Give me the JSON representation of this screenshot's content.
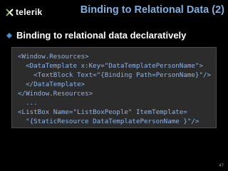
{
  "logo": {
    "text": "telerik"
  },
  "slide": {
    "title": "Binding to Relational Data (2)",
    "bullet": "Binding to relational data declaratively",
    "code_lines": [
      "<Window.Resources>",
      "  <DataTemplate x:Key=\"DataTemplatePersonName\">",
      "    <TextBlock Text=\"{Binding Path=PersonName}\"/>",
      "  </DataTemplate>",
      "</Window.Resources>",
      "  ...",
      "<ListBox Name=\"ListBoxPeople\" ItemTemplate=",
      "  \"{StaticResource DataTemplatePersonName }\"/>"
    ],
    "page_number": "47"
  },
  "colors": {
    "background": "#000000",
    "title": "#7fb0e0",
    "code_text": "#8fb3e8",
    "code_bg": "#2c2c2c",
    "bullet": "#4a90d9"
  }
}
